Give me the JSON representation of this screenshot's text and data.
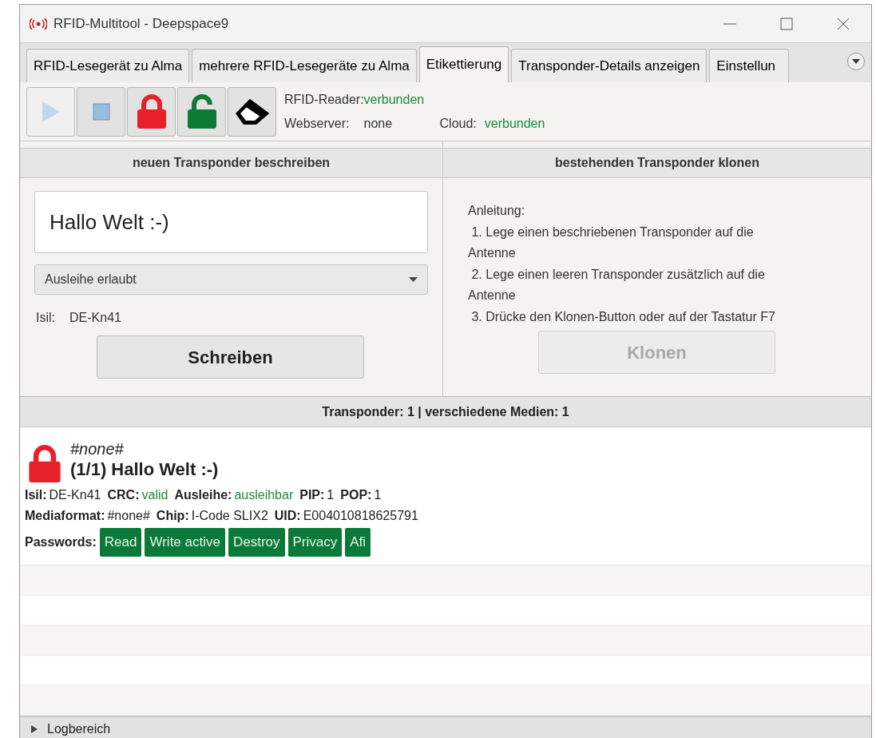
{
  "window": {
    "title": "RFID-Multitool - Deepspace9"
  },
  "tabs": [
    {
      "label": "RFID-Lesegerät zu Alma",
      "selected": false
    },
    {
      "label": "mehrere RFID-Lesegeräte zu Alma",
      "selected": false
    },
    {
      "label": "Etikettierung",
      "selected": true
    },
    {
      "label": "Transponder-Details anzeigen",
      "selected": false
    },
    {
      "label": "Einstellun",
      "selected": false
    }
  ],
  "toolbar": [
    {
      "kind": "play",
      "disabled": true
    },
    {
      "kind": "stop",
      "disabled": false
    },
    {
      "kind": "lock",
      "disabled": false
    },
    {
      "kind": "unlock",
      "disabled": false
    },
    {
      "kind": "erase",
      "disabled": false
    }
  ],
  "status": {
    "reader": {
      "label": "RFID-Reader:",
      "value": "verbunden",
      "ok": true
    },
    "webserver": {
      "label": "Webserver:",
      "value": "none",
      "ok": false
    },
    "cloud": {
      "label": "Cloud:",
      "value": "verbunden",
      "ok": true
    }
  },
  "write_panel": {
    "header": "neuen Transponder beschreiben",
    "text_value": "Hallo Welt :-)",
    "select_value": "Ausleihe erlaubt",
    "isil_label": "Isil:",
    "isil_value": "DE-Kn41",
    "button": {
      "label": "Schreiben",
      "disabled": false
    }
  },
  "clone_panel": {
    "header": "bestehenden Transponder klonen",
    "instructions": [
      "Anleitung:",
      " 1. Lege einen beschriebenen Transponder auf die Antenne",
      " 2. Lege einen leeren Transponder zusätzlich auf die Antenne",
      " 3. Drücke den Klonen-Button oder auf der Tastatur F7"
    ],
    "button": {
      "label": "Klonen",
      "disabled": true
    }
  },
  "summary": "Transponder: 1 | verschiedene Medien: 1",
  "transponders": [
    {
      "locked": true,
      "subtitle": "#none#",
      "title": "(1/1) Hallo Welt :-)",
      "lines": [
        [
          {
            "label": "Isil:",
            "value": "DE-Kn41",
            "ok": false
          },
          {
            "label": "CRC:",
            "value": "valid",
            "ok": true
          },
          {
            "label": "Ausleihe:",
            "value": "ausleihbar",
            "ok": true
          },
          {
            "label": "PIP:",
            "value": "1",
            "ok": false
          },
          {
            "label": "POP:",
            "value": "1",
            "ok": false
          }
        ],
        [
          {
            "label": "Mediaformat:",
            "value": "#none#",
            "ok": false
          },
          {
            "label": "Chip:",
            "value": "I-Code SLIX2",
            "ok": false
          },
          {
            "label": "UID:",
            "value": "E004010818625791",
            "ok": false
          }
        ]
      ],
      "passwords_label": "Passwords:",
      "passwords": [
        {
          "label": "Read",
          "active": true
        },
        {
          "label": "Write active",
          "active": true
        },
        {
          "label": "Destroy",
          "active": true
        },
        {
          "label": "Privacy",
          "active": true
        },
        {
          "label": "Afi",
          "active": true
        }
      ]
    }
  ],
  "log": {
    "label": "Logbereich",
    "expanded": false
  }
}
